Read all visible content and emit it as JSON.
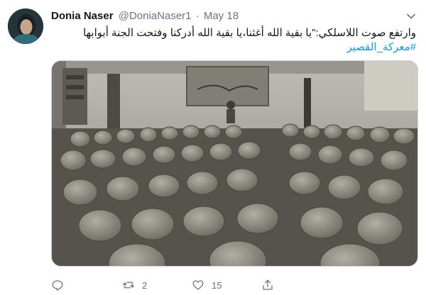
{
  "tweet": {
    "author_name": "Donia Naser",
    "handle": "@DoniaNaser1",
    "separator": "·",
    "date": "May 18",
    "text_line1": "وارتفع صوت اللاسلكي:\"يا بقية الله أغثنا،يا بقية الله أدركنا وفتحت الجنة أبوابها",
    "hashtag": "#معركة_القصير",
    "image_icon": "soldiers-in-hall-photo",
    "counts": {
      "reply": "",
      "retweet": "2",
      "like": "15"
    },
    "icons": {
      "reply": "reply-icon",
      "retweet": "retweet-icon",
      "like": "heart-icon",
      "share": "share-icon",
      "menu": "chevron-down-icon"
    },
    "colors": {
      "hashtag": "#1b95e0",
      "muted": "#657786",
      "text": "#14171a"
    }
  }
}
